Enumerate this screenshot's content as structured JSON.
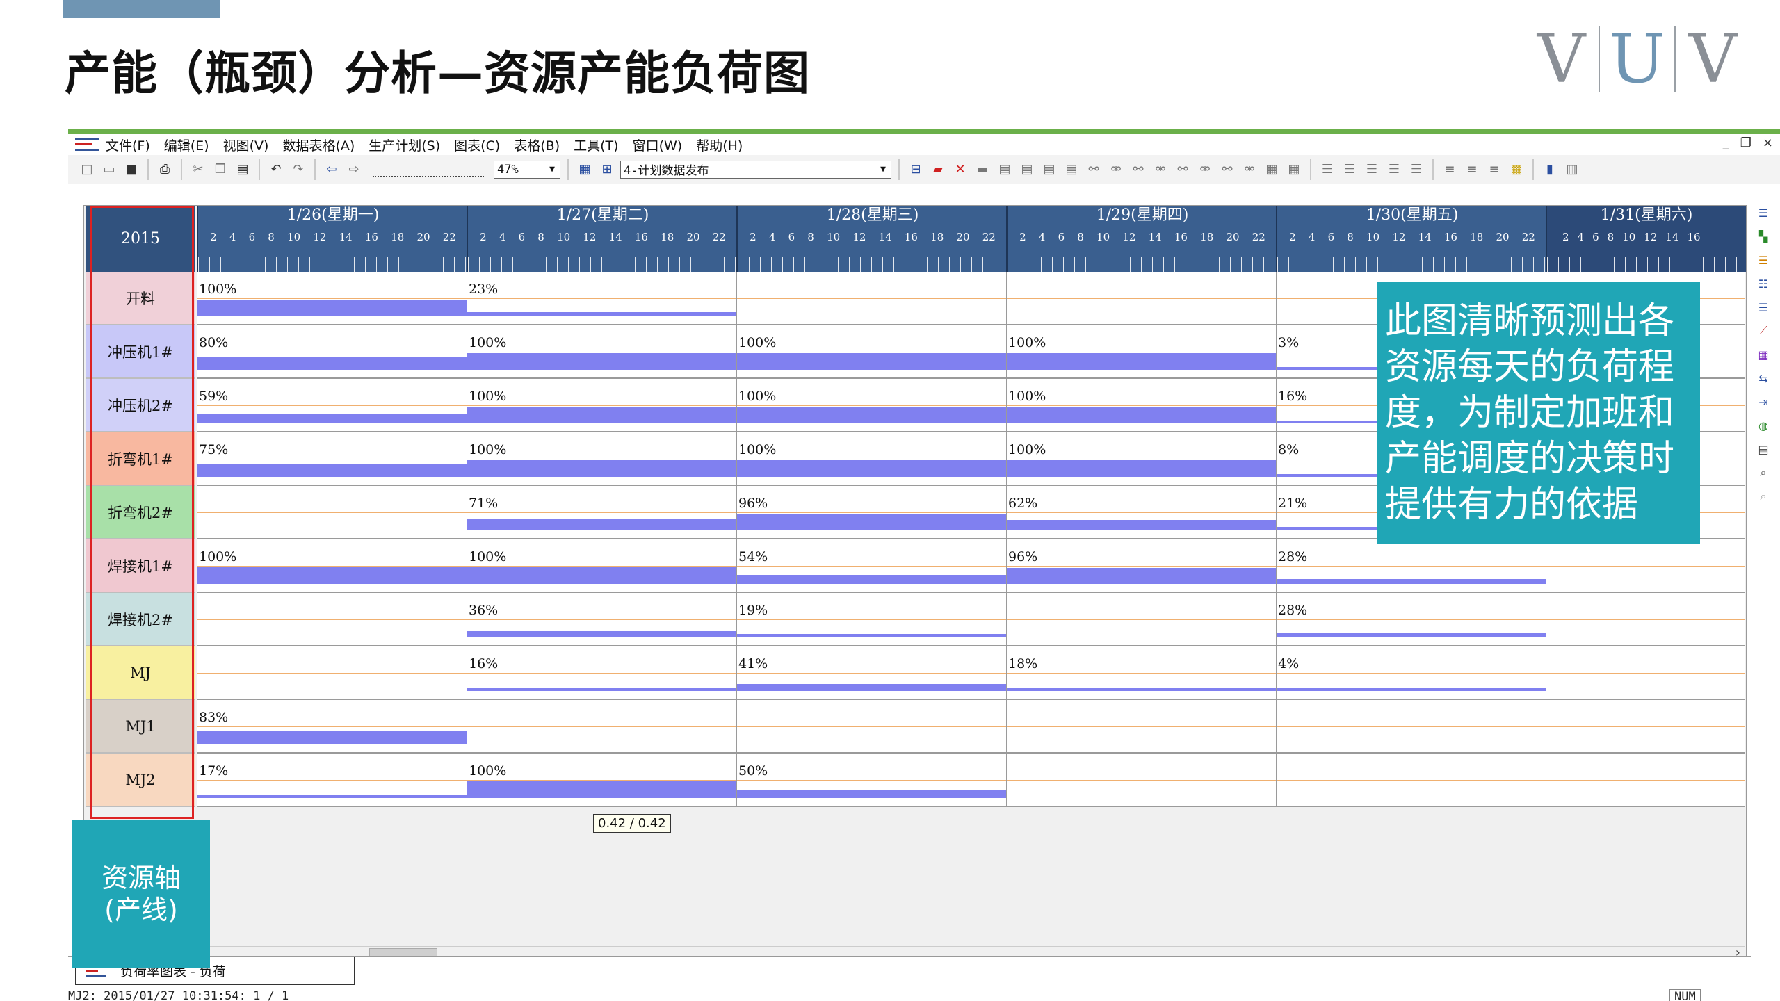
{
  "slide": {
    "title": "产能（瓶颈）分析—资源产能负荷图",
    "logo": [
      "V",
      "U",
      "V"
    ],
    "callout": "此图清晰预测出各资源每天的负荷程度，为制定加班和产能调度的决策时提供有力的依据",
    "axis_label_line1": "资源轴",
    "axis_label_line2": "(产线)"
  },
  "app": {
    "menu": [
      "文件(F)",
      "编辑(E)",
      "视图(V)",
      "数据表格(A)",
      "生产计划(S)",
      "图表(C)",
      "表格(B)",
      "工具(T)",
      "窗口(W)",
      "帮助(H)"
    ],
    "window_controls": [
      "_",
      "❐",
      "×"
    ],
    "toolbar": {
      "zoom_value": "47%",
      "plan_select": "4-计划数据发布"
    },
    "tab_label": "负荷率图表 - 负荷",
    "status_left": "MJ2: 2015/01/27 10:31:54: 1 / 1",
    "status_num": "NUM",
    "tooltip": "0.42 / 0.42"
  },
  "chart_data": {
    "type": "bar",
    "year": "2015",
    "days": [
      "1/26(星期一)",
      "1/27(星期二)",
      "1/28(星期三)",
      "1/29(星期四)",
      "1/30(星期五)",
      "1/31(星期六)"
    ],
    "hour_ticks": [
      "2",
      "4",
      "6",
      "8",
      "10",
      "12",
      "14",
      "16",
      "18",
      "20",
      "22"
    ],
    "last_day_hour_ticks": [
      "2",
      "4",
      "6",
      "8",
      "10",
      "12",
      "14",
      "16"
    ],
    "resources": [
      {
        "name": "开料",
        "color": "#f0d0d8",
        "values": [
          100,
          23,
          null,
          null,
          null,
          null
        ]
      },
      {
        "name": "冲压机1#",
        "color": "#c8c8f8",
        "values": [
          80,
          100,
          100,
          100,
          3,
          null
        ]
      },
      {
        "name": "冲压机2#",
        "color": "#d0d0f8",
        "values": [
          59,
          100,
          100,
          100,
          16,
          null
        ]
      },
      {
        "name": "折弯机1#",
        "color": "#f8b8a0",
        "values": [
          75,
          100,
          100,
          100,
          8,
          null
        ]
      },
      {
        "name": "折弯机2#",
        "color": "#a8e0a8",
        "values": [
          null,
          71,
          96,
          62,
          21,
          null
        ]
      },
      {
        "name": "焊接机1#",
        "color": "#f0c8d0",
        "values": [
          100,
          100,
          54,
          96,
          28,
          null
        ]
      },
      {
        "name": "焊接机2#",
        "color": "#c8e0e0",
        "values": [
          null,
          36,
          19,
          null,
          28,
          null
        ]
      },
      {
        "name": "MJ",
        "color": "#f8f0a0",
        "values": [
          null,
          16,
          41,
          18,
          4,
          null
        ]
      },
      {
        "name": "MJ1",
        "color": "#d8d0c8",
        "values": [
          83,
          null,
          null,
          null,
          null,
          null
        ]
      },
      {
        "name": "MJ2",
        "color": "#f8d8c0",
        "values": [
          17,
          100,
          50,
          null,
          null,
          null
        ]
      }
    ],
    "bar_color": "#8080f0",
    "unit": "%"
  }
}
